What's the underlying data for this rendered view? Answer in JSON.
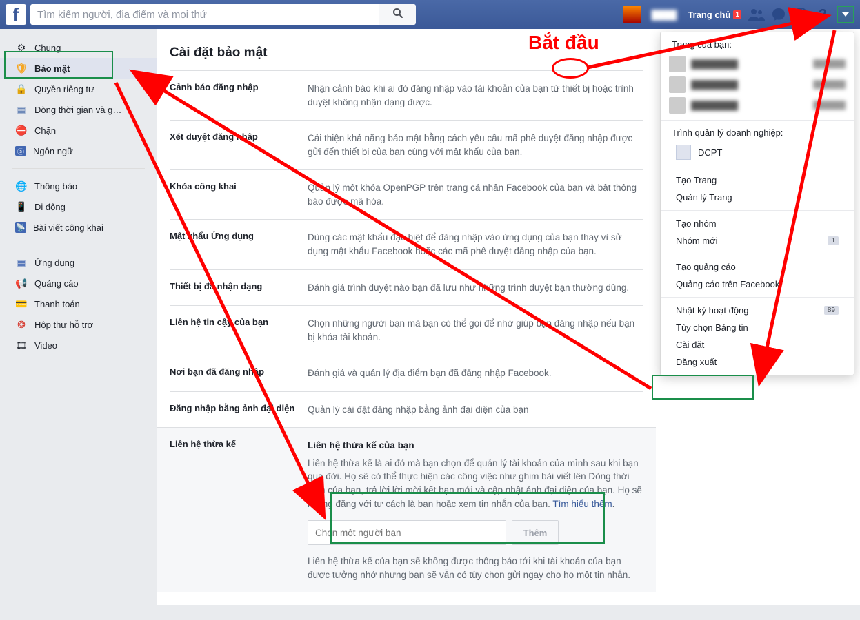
{
  "topbar": {
    "search_placeholder": "Tìm kiếm người, địa điểm và mọi thứ",
    "home_label": "Trang chủ",
    "home_badge": "1"
  },
  "sidebar": {
    "items": [
      {
        "label": "Chung",
        "icon": "⚙"
      },
      {
        "label": "Bảo mật",
        "icon": "🛡"
      },
      {
        "label": "Quyền riêng tư",
        "icon": "🔒"
      },
      {
        "label": "Dòng thời gian và g…",
        "icon": "▦"
      },
      {
        "label": "Chặn",
        "icon": "⛔"
      },
      {
        "label": "Ngôn ngữ",
        "icon": "ⓐ"
      }
    ],
    "group2": [
      {
        "label": "Thông báo",
        "icon": "🌐"
      },
      {
        "label": "Di động",
        "icon": "📱"
      },
      {
        "label": "Bài viết công khai",
        "icon": "📡"
      }
    ],
    "group3": [
      {
        "label": "Ứng dụng",
        "icon": "▦"
      },
      {
        "label": "Quảng cáo",
        "icon": "📢"
      },
      {
        "label": "Thanh toán",
        "icon": "💳"
      },
      {
        "label": "Hộp thư hỗ trợ",
        "icon": "❂"
      },
      {
        "label": "Video",
        "icon": "🎞"
      }
    ]
  },
  "content": {
    "title": "Cài đặt bảo mật",
    "rows": [
      {
        "label": "Cảnh báo đăng nhập",
        "body": "Nhận cảnh báo khi ai đó đăng nhập vào tài khoản của bạn từ thiết bị hoặc trình duyệt không nhận dạng được."
      },
      {
        "label": "Xét duyệt đăng nhập",
        "body": "Cải thiện khả năng bảo mật bằng cách yêu cầu mã phê duyệt đăng nhập được gửi đến thiết bị của bạn cùng với mật khẩu của bạn."
      },
      {
        "label": "Khóa công khai",
        "body": "Quản lý một khóa OpenPGP trên trang cá nhân Facebook của bạn và bật thông báo được mã hóa."
      },
      {
        "label": "Mật khẩu Ứng dụng",
        "body": "Dùng các mật khẩu đặc biệt để đăng nhập vào ứng dụng của bạn thay vì sử dụng mật khẩu Facebook hoặc các mã phê duyệt đăng nhập của bạn."
      },
      {
        "label": "Thiết bị đã nhận dạng",
        "body": "Đánh giá trình duyệt nào bạn đã lưu như những trình duyệt bạn thường dùng."
      },
      {
        "label": "Liên hệ tin cậy của bạn",
        "body": "Chọn những người bạn mà bạn có thể gọi để nhờ giúp bạn đăng nhập nếu bạn bị khóa tài khoản."
      },
      {
        "label": "Nơi bạn đã đăng nhập",
        "body": "Đánh giá và quản lý địa điểm bạn đã đăng nhập Facebook."
      },
      {
        "label": "Đăng nhập bằng ảnh đại diện",
        "body": "Quản lý cài đặt đăng nhập bằng ảnh đại diện của bạn"
      }
    ],
    "legacy": {
      "label": "Liên hệ thừa kế",
      "heading": "Liên hệ thừa kế của bạn",
      "desc": "Liên hệ thừa kế là ai đó mà bạn chọn để quản lý tài khoản của mình sau khi bạn qua đời. Họ sẽ có thể thực hiện các công việc như ghim bài viết lên Dòng thời gian của bạn, trả lời lời mời kết bạn mới và cập nhật ảnh đại diện của bạn. Họ sẽ không đăng với tư cách là bạn hoặc xem tin nhắn của bạn.",
      "learn_more": "Tìm hiểu thêm",
      "friend_placeholder": "Chọn một người bạn",
      "add_label": "Thêm",
      "note": "Liên hệ thừa kế của bạn sẽ không được thông báo tới khi tài khoản của bạn được tưởng nhớ nhưng bạn sẽ vẫn có tùy chọn gửi ngay cho họ một tin nhắn."
    }
  },
  "dropdown": {
    "pages_heading": "Trang của bạn:",
    "biz_heading": "Trình quản lý doanh nghiệp:",
    "biz_name": "DCPT",
    "items1": [
      {
        "label": "Tạo Trang"
      },
      {
        "label": "Quản lý Trang"
      }
    ],
    "items2": [
      {
        "label": "Tạo nhóm"
      },
      {
        "label": "Nhóm mới",
        "badge": "1"
      }
    ],
    "items3": [
      {
        "label": "Tạo quảng cáo"
      },
      {
        "label": "Quảng cáo trên Facebook"
      }
    ],
    "items4": [
      {
        "label": "Nhật ký hoạt động",
        "badge": "89"
      },
      {
        "label": "Tùy chọn Bảng tin"
      },
      {
        "label": "Cài đặt"
      },
      {
        "label": "Đăng xuất"
      }
    ]
  },
  "annotation": {
    "start": "Bắt đầu"
  }
}
